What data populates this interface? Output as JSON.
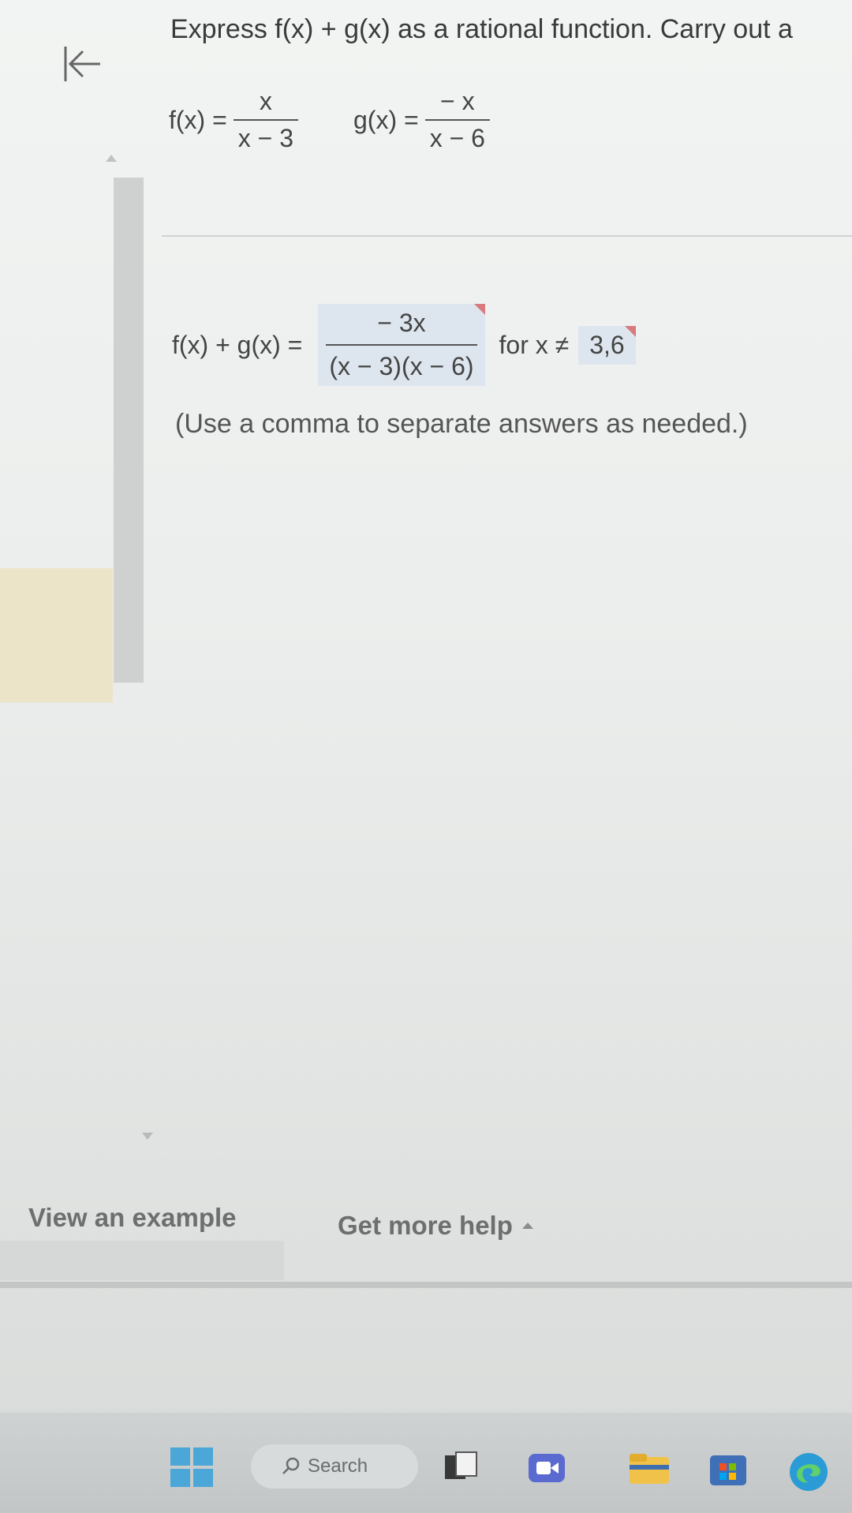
{
  "question": {
    "prompt": "Express f(x) + g(x) as a rational function. Carry out a"
  },
  "functions": {
    "f": {
      "lhs": "f(x) =",
      "numerator": "x",
      "denominator": "x − 3"
    },
    "g": {
      "lhs": "g(x) =",
      "numerator": "− x",
      "denominator": "x − 6"
    }
  },
  "answer": {
    "lhs": "f(x) + g(x) =",
    "numerator": "− 3x",
    "denominator": "(x − 3)(x − 6)",
    "for_label": "for x ≠",
    "excluded_values": "3,6",
    "hint": "(Use a comma to separate answers as needed.)"
  },
  "footer": {
    "view_example": "View an example",
    "get_more_help": "Get more help"
  },
  "taskbar": {
    "search_label": "Search"
  },
  "colors": {
    "answer_box_bg": "#dde6ee",
    "error_marker": "#d97a7e",
    "start_blue": "#4aa7d8"
  }
}
